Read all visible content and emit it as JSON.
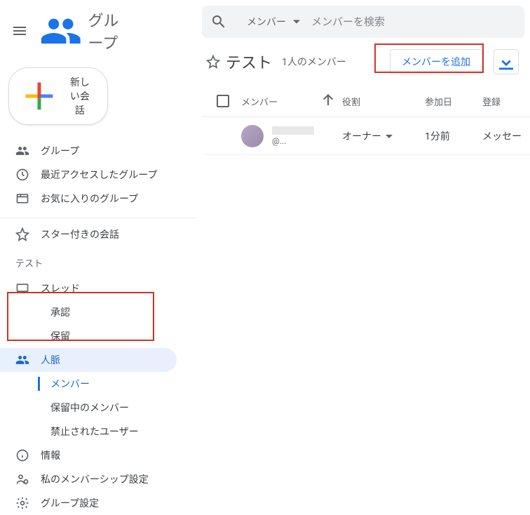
{
  "header": {
    "app_name": "グループ"
  },
  "compose": {
    "label": "新しい会話"
  },
  "nav": {
    "groups": "グループ",
    "recent": "最近アクセスしたグループ",
    "favorites": "お気に入りのグループ",
    "starred": "スター付きの会話"
  },
  "group_section": {
    "name": "テスト",
    "threads": "スレッド",
    "approve": "承認",
    "pending": "保留",
    "people": "人脈",
    "members": "メンバー",
    "pending_members": "保留中のメンバー",
    "banned": "禁止されたユーザー",
    "about": "情報",
    "my_settings": "私のメンバーシップ設定",
    "group_settings": "グループ設定"
  },
  "search": {
    "scope": "メンバー",
    "placeholder": "メンバーを検索"
  },
  "page": {
    "title": "テスト",
    "member_count": "1人のメンバー",
    "add_member": "メンバーを追加"
  },
  "table": {
    "col_member": "メンバー",
    "col_role": "役割",
    "col_joined": "参加日",
    "col_sub": "登録"
  },
  "rows": [
    {
      "email_masked": "@...",
      "role": "オーナー",
      "joined": "1分前",
      "sub": "メッセー"
    }
  ]
}
